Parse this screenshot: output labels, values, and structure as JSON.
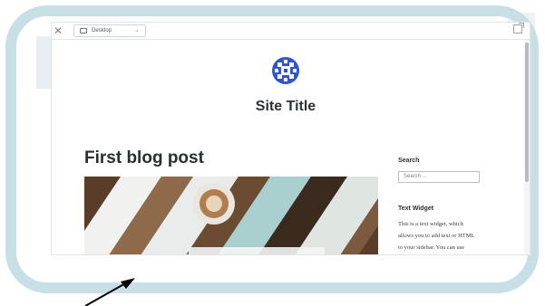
{
  "toolbar": {
    "device_label": "Desktop"
  },
  "site": {
    "title": "Site Title"
  },
  "post": {
    "title": "First blog post"
  },
  "sidebar": {
    "search_title": "Search",
    "search_placeholder": "Search ...",
    "text_widget_title": "Text Widget",
    "text_widget_lines": [
      "This is a text widget, which",
      "allows you to add text or HTML",
      "to your sidebar. You can use"
    ]
  },
  "icons": {
    "close": "close-icon",
    "device": "monitor-icon",
    "dropdown": "chevron-down-icon",
    "external": "external-link-icon",
    "logo": "site-logo",
    "arrow": "arrow-pointer"
  },
  "colors": {
    "frame": "#c9dfe6",
    "logo_blue": "#2f55d4",
    "title_text": "#2f3234",
    "arrow": "#000000"
  }
}
